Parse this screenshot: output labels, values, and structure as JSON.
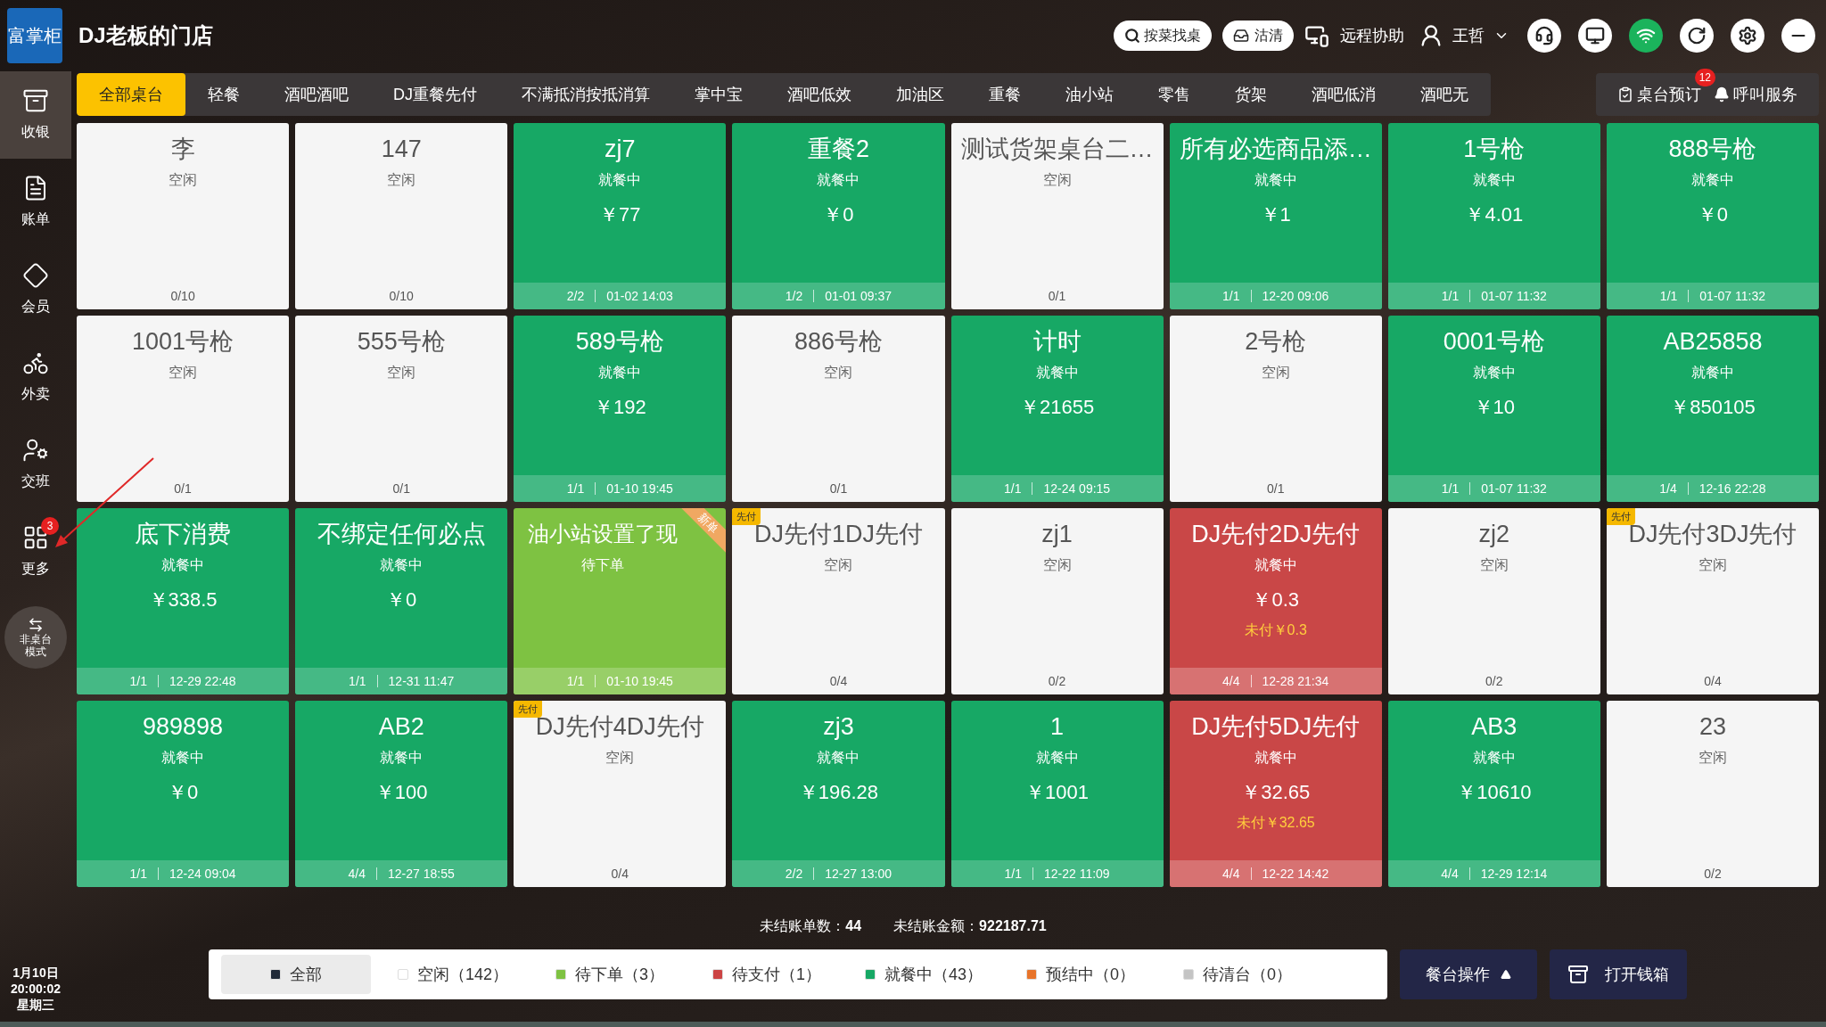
{
  "header": {
    "logo": "富掌柜",
    "store_name": "DJ老板的门店",
    "search_button": "按菜找桌",
    "soldout_button": "沽清",
    "remote_help": "远程协助",
    "user": "王哲"
  },
  "sidebar": {
    "items": [
      {
        "label": "收银",
        "selected": true
      },
      {
        "label": "账单",
        "selected": false
      },
      {
        "label": "会员",
        "selected": false
      },
      {
        "label": "外卖",
        "selected": false
      },
      {
        "label": "交班",
        "selected": false
      },
      {
        "label": "更多",
        "selected": false,
        "badge": "3"
      }
    ],
    "mode_button": "非桌台模式",
    "date": "1月10日",
    "time": "20:00:02",
    "weekday": "星期三"
  },
  "tabs": [
    {
      "label": "全部桌台",
      "selected": true
    },
    {
      "label": "轻餐",
      "selected": false
    },
    {
      "label": "酒吧酒吧",
      "selected": false
    },
    {
      "label": "DJ重餐先付",
      "selected": false
    },
    {
      "label": "不满抵消按抵消算",
      "selected": false
    },
    {
      "label": "掌中宝",
      "selected": false
    },
    {
      "label": "酒吧低效",
      "selected": false
    },
    {
      "label": "加油区",
      "selected": false
    },
    {
      "label": "重餐",
      "selected": false
    },
    {
      "label": "油小站",
      "selected": false
    },
    {
      "label": "零售",
      "selected": false
    },
    {
      "label": "货架",
      "selected": false
    },
    {
      "label": "酒吧低消",
      "selected": false
    },
    {
      "label": "酒吧无",
      "selected": false
    }
  ],
  "tab_actions": {
    "reservation": "桌台预订",
    "reservation_badge": "12",
    "call_service": "呼叫服务"
  },
  "tables": [
    {
      "name": "李",
      "kind": "idle",
      "status": "空闲",
      "seats": "0/10"
    },
    {
      "name": "147",
      "kind": "idle",
      "status": "空闲",
      "seats": "0/10"
    },
    {
      "name": "zj7",
      "kind": "dining",
      "status": "就餐中",
      "amount": "￥77",
      "seats": "2/2",
      "time": "01-02 14:03"
    },
    {
      "name": "重餐2",
      "kind": "dining",
      "status": "就餐中",
      "amount": "￥0",
      "seats": "1/2",
      "time": "01-01 09:37"
    },
    {
      "name": "测试货架桌台二…",
      "kind": "idle",
      "status": "空闲",
      "seats": "0/1"
    },
    {
      "name": "所有必选商品添…",
      "kind": "dining",
      "status": "就餐中",
      "amount": "￥1",
      "seats": "1/1",
      "time": "12-20 09:06"
    },
    {
      "name": "1号枪",
      "kind": "dining",
      "status": "就餐中",
      "amount": "￥4.01",
      "seats": "1/1",
      "time": "01-07 11:32"
    },
    {
      "name": "888号枪",
      "kind": "dining",
      "status": "就餐中",
      "amount": "￥0",
      "seats": "1/1",
      "time": "01-07 11:32"
    },
    {
      "name": "1001号枪",
      "kind": "idle",
      "status": "空闲",
      "seats": "0/1"
    },
    {
      "name": "555号枪",
      "kind": "idle",
      "status": "空闲",
      "seats": "0/1"
    },
    {
      "name": "589号枪",
      "kind": "dining",
      "status": "就餐中",
      "amount": "￥192",
      "seats": "1/1",
      "time": "01-10 19:45"
    },
    {
      "name": "886号枪",
      "kind": "idle",
      "status": "空闲",
      "seats": "0/1"
    },
    {
      "name": "计时",
      "kind": "dining",
      "status": "就餐中",
      "amount": "￥21655",
      "seats": "1/1",
      "time": "12-24 09:15"
    },
    {
      "name": "2号枪",
      "kind": "idle",
      "status": "空闲",
      "seats": "0/1"
    },
    {
      "name": "0001号枪",
      "kind": "dining",
      "status": "就餐中",
      "amount": "￥10",
      "seats": "1/1",
      "time": "01-07 11:32"
    },
    {
      "name": "AB25858",
      "kind": "dining",
      "status": "就餐中",
      "amount": "￥850105",
      "seats": "1/4",
      "time": "12-16 22:28"
    },
    {
      "name": "底下消费",
      "kind": "dining",
      "status": "就餐中",
      "amount": "￥338.5",
      "seats": "1/1",
      "time": "12-29 22:48"
    },
    {
      "name": "不绑定任何必点",
      "kind": "dining",
      "status": "就餐中",
      "amount": "￥0",
      "seats": "1/1",
      "time": "12-31 11:47"
    },
    {
      "name": "油小站设置了现",
      "kind": "pending",
      "status": "待下单",
      "seats": "1/1",
      "time": "01-10 19:45",
      "ribbon": "新单"
    },
    {
      "name": "DJ先付1DJ先付",
      "kind": "idle",
      "status": "空闲",
      "seats": "0/4",
      "tag": "先付"
    },
    {
      "name": "zj1",
      "kind": "idle",
      "status": "空闲",
      "seats": "0/2"
    },
    {
      "name": "DJ先付2DJ先付",
      "kind": "unpaid",
      "status": "就餐中",
      "amount": "￥0.3",
      "unpaid": "未付￥0.3",
      "seats": "4/4",
      "time": "12-28 21:34"
    },
    {
      "name": "zj2",
      "kind": "idle",
      "status": "空闲",
      "seats": "0/2"
    },
    {
      "name": "DJ先付3DJ先付",
      "kind": "idle",
      "status": "空闲",
      "seats": "0/4",
      "tag": "先付"
    },
    {
      "name": "989898",
      "kind": "dining",
      "status": "就餐中",
      "amount": "￥0",
      "seats": "1/1",
      "time": "12-24 09:04"
    },
    {
      "name": "AB2",
      "kind": "dining",
      "status": "就餐中",
      "amount": "￥100",
      "seats": "4/4",
      "time": "12-27 18:55"
    },
    {
      "name": "DJ先付4DJ先付",
      "kind": "idle",
      "status": "空闲",
      "seats": "0/4",
      "tag": "先付"
    },
    {
      "name": "zj3",
      "kind": "dining",
      "status": "就餐中",
      "amount": "￥196.28",
      "seats": "2/2",
      "time": "12-27 13:00"
    },
    {
      "name": "1",
      "kind": "dining",
      "status": "就餐中",
      "amount": "￥1001",
      "seats": "1/1",
      "time": "12-22 11:09"
    },
    {
      "name": "DJ先付5DJ先付",
      "kind": "unpaid",
      "status": "就餐中",
      "amount": "￥32.65",
      "unpaid": "未付￥32.65",
      "seats": "4/4",
      "time": "12-22 14:42"
    },
    {
      "name": "AB3",
      "kind": "dining",
      "status": "就餐中",
      "amount": "￥10610",
      "seats": "4/4",
      "time": "12-29 12:14"
    },
    {
      "name": "23",
      "kind": "idle",
      "status": "空闲",
      "seats": "0/2"
    }
  ],
  "summary": {
    "open_orders": "未结账单数：",
    "open_orders_value": "44",
    "open_amount": "未结账金额：",
    "open_amount_value": "922187.71"
  },
  "filters": [
    {
      "label": "全部",
      "color": "#1f2937",
      "selected": true
    },
    {
      "label": "空闲（142）",
      "color": "#ffffff",
      "selected": false
    },
    {
      "label": "待下单（3）",
      "color": "#7ec242",
      "selected": false
    },
    {
      "label": "待支付（1）",
      "color": "#cc4444",
      "selected": false
    },
    {
      "label": "就餐中（43）",
      "color": "#16a865",
      "selected": false
    },
    {
      "label": "预结中（0）",
      "color": "#e8742a",
      "selected": false
    },
    {
      "label": "待清台（0）",
      "color": "#c4c4c4",
      "selected": false
    }
  ],
  "actions": {
    "table_ops": "餐台操作",
    "open_drawer": "打开钱箱"
  }
}
